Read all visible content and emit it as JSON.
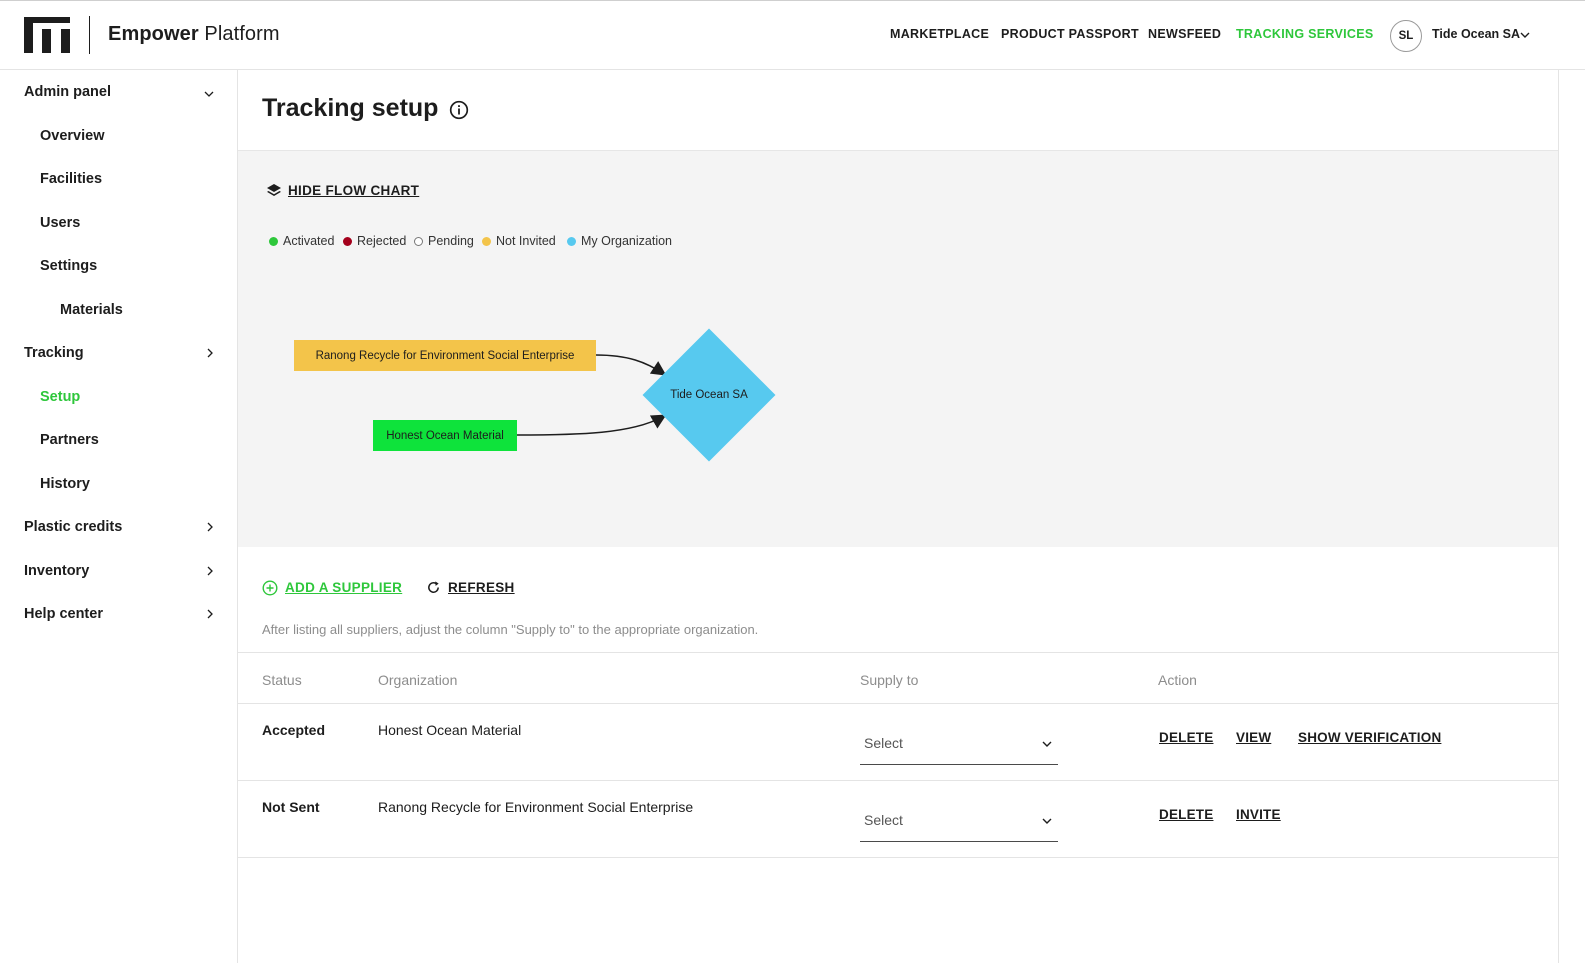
{
  "header": {
    "brand_bold": "Empower",
    "brand_rest": " Platform",
    "nav": [
      {
        "label": "MARKETPLACE"
      },
      {
        "label": "PRODUCT PASSPORT"
      },
      {
        "label": "NEWSFEED"
      },
      {
        "label": "TRACKING SERVICES",
        "active": true
      }
    ],
    "avatar_initials": "SL",
    "org_name": "Tide Ocean SA"
  },
  "sidebar": {
    "items": [
      {
        "label": "Admin panel",
        "level": 0,
        "chevron": "chevron-down-icon"
      },
      {
        "label": "Overview",
        "level": 1
      },
      {
        "label": "Facilities",
        "level": 1
      },
      {
        "label": "Users",
        "level": 1
      },
      {
        "label": "Settings",
        "level": 1
      },
      {
        "label": "Materials",
        "level": 2
      },
      {
        "label": "Tracking",
        "level": 0,
        "chevron": "chevron-right-icon"
      },
      {
        "label": "Setup",
        "level": 1,
        "active": true
      },
      {
        "label": "Partners",
        "level": 1
      },
      {
        "label": "History",
        "level": 1
      },
      {
        "label": "Plastic credits",
        "level": 0,
        "chevron": "chevron-right-icon"
      },
      {
        "label": "Inventory",
        "level": 0,
        "chevron": "chevron-right-icon"
      },
      {
        "label": "Help center",
        "level": 0,
        "chevron": "chevron-right-icon"
      }
    ]
  },
  "page": {
    "title": "Tracking setup",
    "hide_flow_chart": "HIDE FLOW CHART",
    "legend": [
      {
        "label": "Activated",
        "color": "#2ec73b"
      },
      {
        "label": "Rejected",
        "color": "#a4001c"
      },
      {
        "label": "Pending",
        "color": "#ffffff"
      },
      {
        "label": "Not Invited",
        "color": "#f3c44a"
      },
      {
        "label": "My Organization",
        "color": "#57c9ef"
      }
    ],
    "flow": {
      "nodes": [
        {
          "label": "Ranong Recycle for Environment Social Enterprise",
          "status": "Not Invited",
          "color": "#f3c44a"
        },
        {
          "label": "Honest Ocean Material",
          "status": "Activated",
          "color": "#0ee33b"
        },
        {
          "label": "Tide Ocean SA",
          "status": "My Organization",
          "color": "#57c9ef"
        }
      ]
    },
    "add_supplier": "ADD A SUPPLIER",
    "refresh": "REFRESH",
    "hint": "After listing all suppliers, adjust the column \"Supply to\" to the appropriate organization.",
    "table": {
      "headers": [
        "Status",
        "Organization",
        "Supply to",
        "Action"
      ],
      "rows": [
        {
          "status": "Accepted",
          "organization": "Honest Ocean Material",
          "supply_to": "Select",
          "actions": [
            "DELETE",
            "VIEW",
            "SHOW VERIFICATION"
          ]
        },
        {
          "status": "Not Sent",
          "organization": "Ranong Recycle for Environment Social Enterprise",
          "supply_to": "Select",
          "actions": [
            "DELETE",
            "INVITE"
          ]
        }
      ]
    }
  }
}
